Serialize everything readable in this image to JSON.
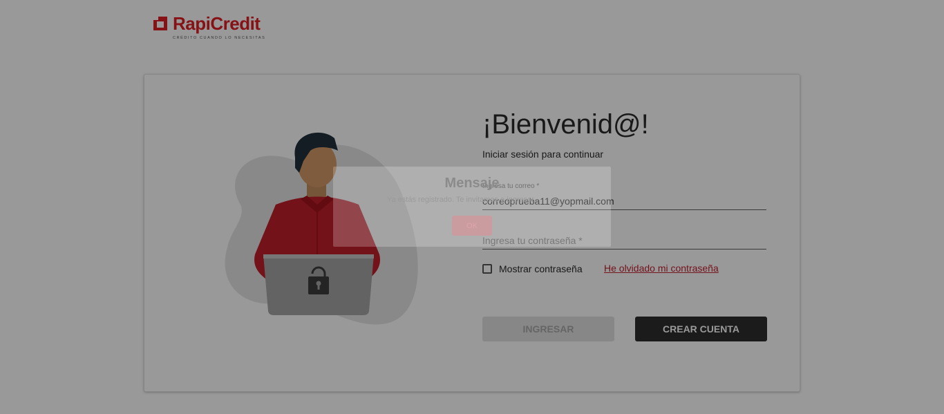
{
  "brand": {
    "name": "RapiCredit",
    "tagline": "CRÉDITO CUANDO LO NECESITAS"
  },
  "login": {
    "welcome": "¡Bienvenid@!",
    "subtitle": "Iniciar sesión para continuar",
    "email_label": "Ingresa tu correo *",
    "email_value": "correoprueba11@yopmail.com",
    "password_placeholder": "Ingresa tu contraseña *",
    "show_password_label": "Mostrar contraseña",
    "forgot_password_link": "He olvidado mi contraseña",
    "login_button": "INGRESAR",
    "create_account_button": "CREAR CUENTA"
  },
  "dialog": {
    "title": "Mensaje",
    "message": "Ya estás registrado. Te invitamos a ingresar",
    "ok_button": "OK"
  },
  "colors": {
    "brand_red": "#e01f26",
    "link_red": "#c0202e",
    "dark_button": "#2d2d2d"
  }
}
